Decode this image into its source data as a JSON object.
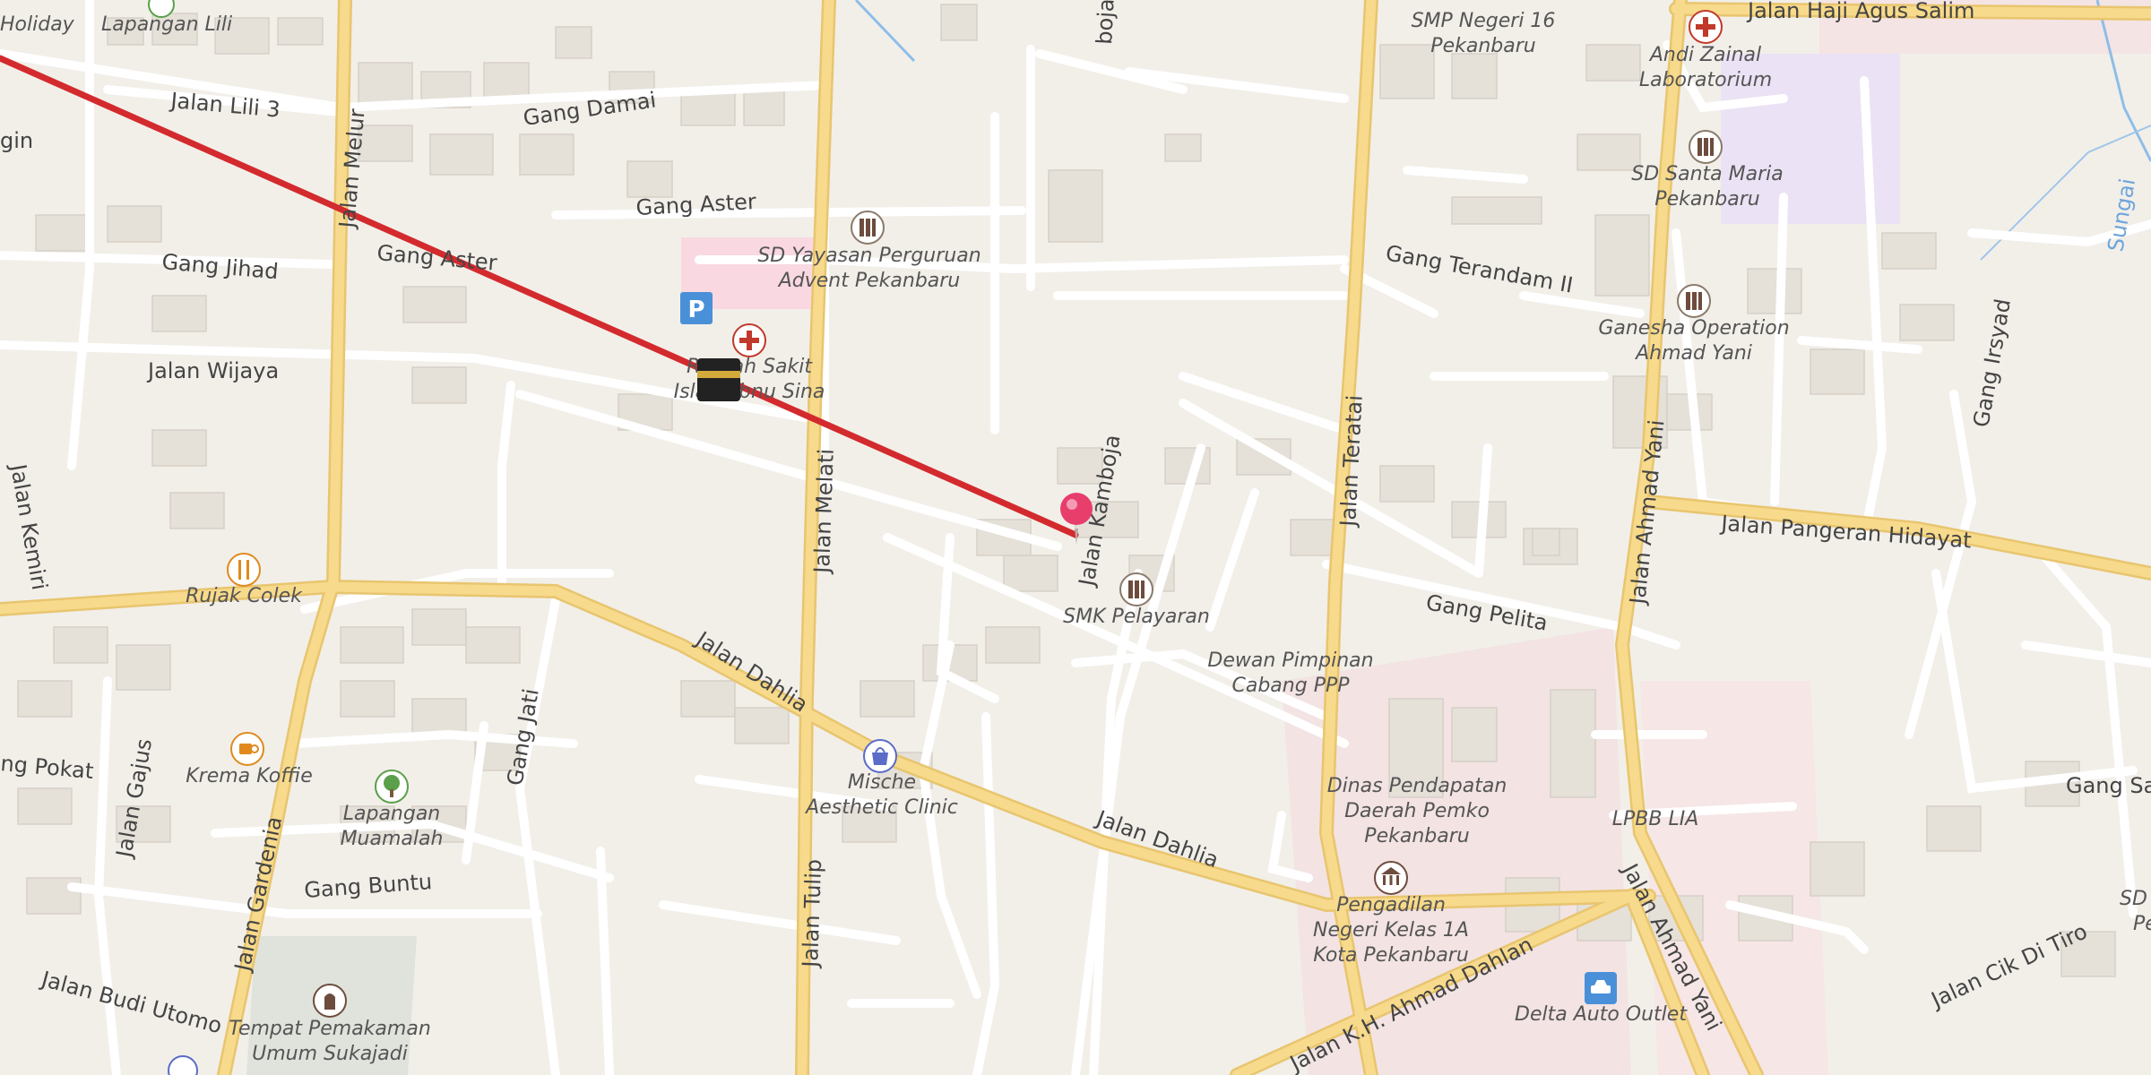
{
  "map": {
    "route_color": "#d32a2e",
    "road_color_major": "#f7da8b",
    "road_color_minor": "#ffffff",
    "water_label": "Sungai",
    "roads": {
      "lili3": "Jalan Lili 3",
      "gang_damai": "Gang Damai",
      "gang_aster_1": "Gang Aster",
      "gang_aster_2": "Gang Aster",
      "gang_jihad": "Gang Jihad",
      "jalan_wijaya": "Jalan Wijaya",
      "jalan_melur": "Jalan Melur",
      "jalan_melati": "Jalan Melati",
      "jalan_kamboja_top": "boja",
      "jalan_kamboja": "Jalan Kamboja",
      "jalan_teratai": "Jalan Teratai",
      "jalan_ahmad_yani_1": "Jalan Ahmad Yani",
      "jalan_ahmad_yani_2": "Jalan Ahmad Yani",
      "gang_terandam": "Gang Terandam II",
      "jalan_haji_agus_salim": "Jalan Haji Agus Salim",
      "jalan_pangeran_hidayat": "Jalan Pangeran Hidayat",
      "gang_irsyad": "Gang Irsyad",
      "gang_pelita": "Gang Pelita",
      "jalan_dahlia_1": "Jalan Dahlia",
      "jalan_dahlia_2": "Jalan Dahlia",
      "jalan_gajus": "Jalan Gajus",
      "gang_pokat": "ng Pokat",
      "jalan_gardenia": "Jalan Gardenia",
      "gang_jati": "Gang Jati",
      "gang_buntu": "Gang Buntu",
      "jalan_tulip": "Jalan Tulip",
      "jalan_budi_utomo": "Jalan Budi Utomo",
      "jalan_kh_ahmad_dahlan": "Jalan K.H. Ahmad Dahlan",
      "jalan_cik_di_tiro": "Jalan Cik Di Tiro",
      "gang_sa": "Gang Sa",
      "jalan_kemiri": "Jalan Kemiri",
      "gin": "gin"
    },
    "pois": {
      "holiday": "Holiday",
      "lapangan_lili": "Lapangan Lili",
      "smp16_line1": "SMP Negeri 16",
      "smp16_line2": "Pekanbaru",
      "andi_line1": "Andi Zainal",
      "andi_line2": "Laboratorium",
      "sd_santa_line1": "SD Santa Maria",
      "sd_santa_line2": "Pekanbaru",
      "sd_yayasan_line1": "SD Yayasan Perguruan",
      "sd_yayasan_line2": "Advent Pekanbaru",
      "rs_line1": "Rumah Sakit",
      "rs_line2": "Islam Ibnu Sina",
      "ganesha_line1": "Ganesha Operation",
      "ganesha_line2": "Ahmad Yani",
      "smk": "SMK Pelayaran",
      "dewan_line1": "Dewan Pimpinan",
      "dewan_line2": "Cabang PPP",
      "rujak": "Rujak Colek",
      "krema": "Krema Koffie",
      "lapangan_muamalah_line1": "Lapangan",
      "lapangan_muamalah_line2": "Muamalah",
      "mische_line1": "Mische",
      "mische_line2": "Aesthetic Clinic",
      "dinas_line1": "Dinas Pendapatan",
      "dinas_line2": "Daerah Pemko",
      "dinas_line3": "Pekanbaru",
      "lpbb": "LPBB LIA",
      "pengadilan_line1": "Pengadilan",
      "pengadilan_line2": "Negeri Kelas 1A",
      "pengadilan_line3": "Kota Pekanbaru",
      "tpu_line1": "Tempat Pemakaman",
      "tpu_line2": "Umum Sukajadi",
      "delta": "Delta Auto Outlet",
      "sd_right": "SD",
      "pe_right": "Pe"
    },
    "icons": {
      "parking": "P"
    }
  }
}
